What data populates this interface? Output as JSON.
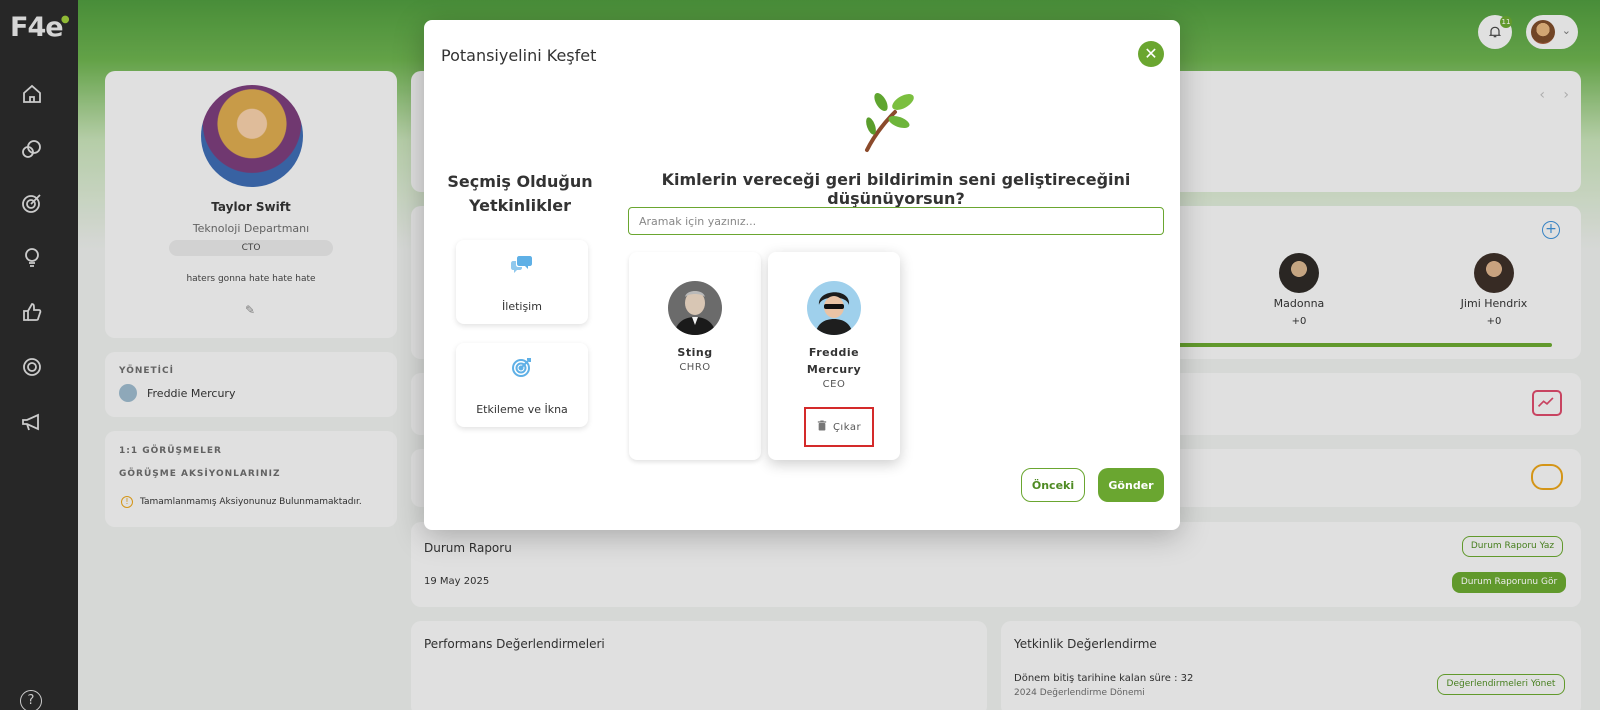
{
  "app": {
    "logo": "F4e"
  },
  "sidebar": {
    "items": [
      {
        "icon": "home-icon"
      },
      {
        "icon": "chat-bubbles-icon"
      },
      {
        "icon": "target-icon"
      },
      {
        "icon": "lightbulb-icon"
      },
      {
        "icon": "thumbs-up-icon"
      },
      {
        "icon": "circle-gear-icon"
      },
      {
        "icon": "megaphone-icon"
      },
      {
        "icon": "help-icon",
        "label": "?"
      }
    ]
  },
  "header": {
    "notifications_count": "11"
  },
  "profile": {
    "name": "Taylor Swift",
    "department": "Teknoloji Departmanı",
    "title": "CTO",
    "bio": "haters gonna hate hate hate"
  },
  "manager": {
    "label": "YÖNETİCİ",
    "name": "Freddie Mercury"
  },
  "meetings": {
    "label": "1:1 GÖRÜŞMELER",
    "actions_label": "GÖRÜŞME AKSİYONLARINIZ",
    "notice": "Tamamlanmamış Aksiyonunuz Bulunmamaktadır."
  },
  "team": [
    {
      "name": "Madonna",
      "score": "+0"
    },
    {
      "name": "Jimi Hendrix",
      "score": "+0"
    }
  ],
  "status_report": {
    "title": "Durum Raporu",
    "date": "19 May 2025",
    "write_label": "Durum Raporu Yaz",
    "view_label": "Durum Raporunu Gör"
  },
  "performance": {
    "title": "Performans Değerlendirmeleri"
  },
  "competency_eval": {
    "title": "Yetkinlik Değerlendirme",
    "remaining": "Dönem bitiş tarihine kalan süre : 32",
    "period": "2024 Değerlendirme Dönemi",
    "manage_label": "Değerlendirmeleri Yönet"
  },
  "modal": {
    "title": "Potansiyelini Keşfet",
    "left_title": "Seçmiş Olduğun Yetkinlikler",
    "competencies": [
      {
        "label": "İletişim",
        "icon": "speech-bubbles-icon"
      },
      {
        "label": "Etkileme ve İkna",
        "icon": "target-arrow-icon"
      }
    ],
    "question": "Kimlerin vereceği geri bildirimin seni geliştireceğini düşünüyorsun?",
    "search_placeholder": "Aramak için yazınız...",
    "people": [
      {
        "name": "Sting",
        "role": "CHRO",
        "selected": false
      },
      {
        "name": "Freddie Mercury",
        "role": "CEO",
        "selected": true
      }
    ],
    "remove_label": "Çıkar",
    "prev_label": "Önceki",
    "send_label": "Gönder"
  },
  "colors": {
    "accent": "#6aa630",
    "sidebar": "#2b2b2b",
    "highlight": "#d42a2a"
  }
}
